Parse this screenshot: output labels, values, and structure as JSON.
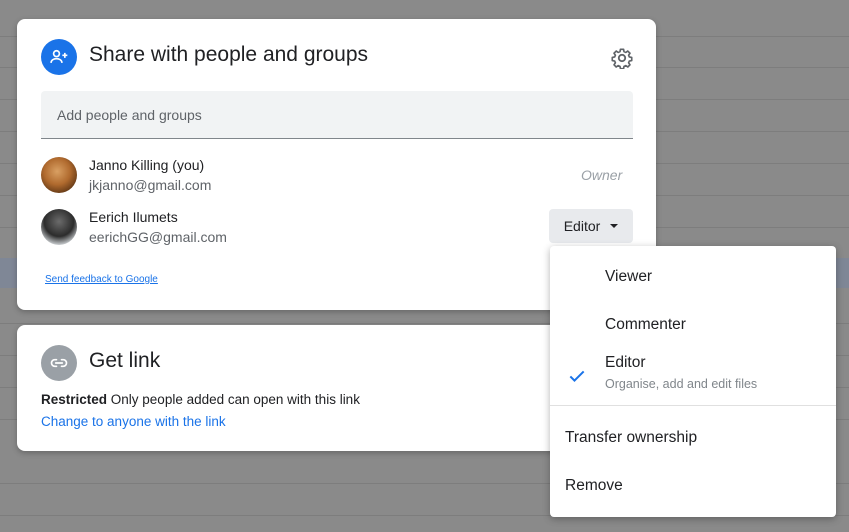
{
  "share_dialog": {
    "title": "Share with people and groups",
    "search_placeholder": "Add people and groups",
    "people": [
      {
        "name": "Janno Killing (you)",
        "email": "jkjanno@gmail.com",
        "role": "Owner"
      },
      {
        "name": "Eerich Ilumets",
        "email": "eerichGG@gmail.com",
        "role": "Editor"
      }
    ],
    "feedback_link": "Send feedback to Google"
  },
  "get_link": {
    "title": "Get link",
    "restricted_label": "Restricted",
    "restricted_text": " Only people added can open with this link",
    "change_link": "Change to anyone with the link"
  },
  "role_menu": {
    "items": [
      {
        "label": "Viewer",
        "checked": false
      },
      {
        "label": "Commenter",
        "checked": false
      },
      {
        "label": "Editor",
        "sub": "Organise, add and edit files",
        "checked": true
      },
      {
        "label": "Transfer ownership"
      },
      {
        "label": "Remove"
      }
    ]
  },
  "colors": {
    "accent": "#1a73e8",
    "overlay": "#8a8a8a"
  }
}
